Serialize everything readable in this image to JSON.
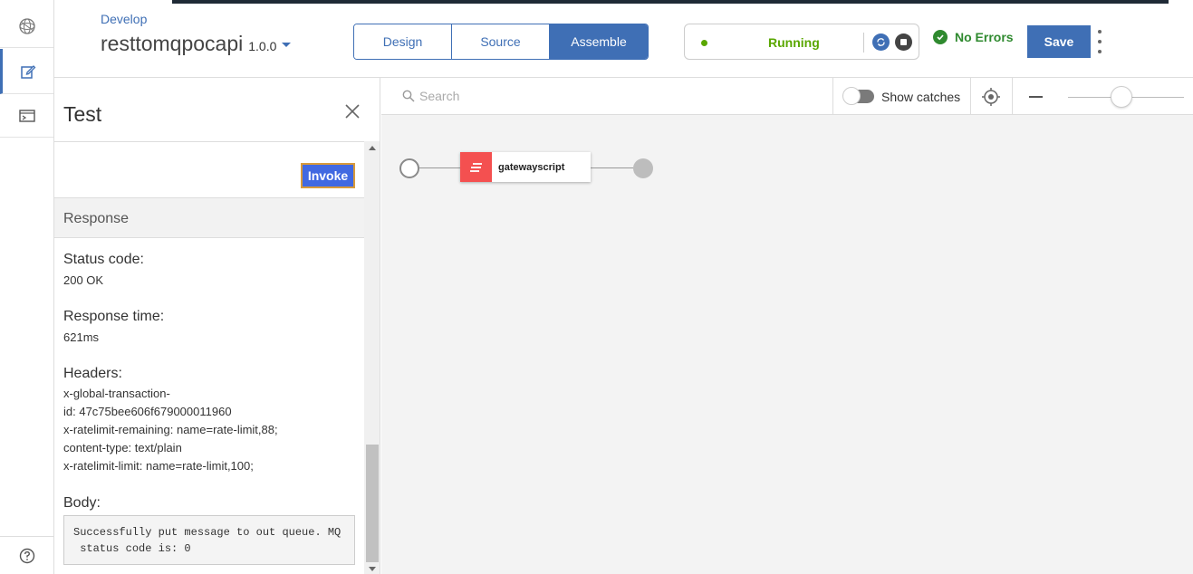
{
  "header": {
    "breadcrumb": "Develop",
    "api_name": "resttomqpocapi",
    "api_version": "1.0.0",
    "tabs": [
      {
        "label": "Design",
        "active": false
      },
      {
        "label": "Source",
        "active": false
      },
      {
        "label": "Assemble",
        "active": true
      }
    ],
    "status": "Running",
    "status_color": "#5aa700",
    "validation": "No Errors",
    "save_label": "Save"
  },
  "sidebar": {
    "items": [
      {
        "icon": "api-connect-logo-icon"
      },
      {
        "icon": "edit-icon",
        "active": true
      },
      {
        "icon": "terminal-icon"
      }
    ],
    "help_icon": "help-icon"
  },
  "test_panel": {
    "title": "Test",
    "invoke_label": "Invoke",
    "response_heading": "Response",
    "status_code_label": "Status code:",
    "status_code_value": "200 OK",
    "response_time_label": "Response time:",
    "response_time_value": "621ms",
    "headers_label": "Headers:",
    "headers": [
      "x-global-transaction-",
      "id: 47c75bee606f679000011960",
      "x-ratelimit-remaining: name=rate-limit,88;",
      "content-type: text/plain",
      "x-ratelimit-limit: name=rate-limit,100;"
    ],
    "body_label": "Body:",
    "body_value": "Successfully put message to out queue. MQ\n status code is: 0"
  },
  "canvas": {
    "search_placeholder": "Search",
    "show_catches_label": "Show catches",
    "show_catches_on": false,
    "policies": [
      {
        "label": "gatewayscript",
        "color": "#f45050"
      }
    ]
  },
  "colors": {
    "accent": "#3f6fb5",
    "invoke": "#4169e1"
  }
}
